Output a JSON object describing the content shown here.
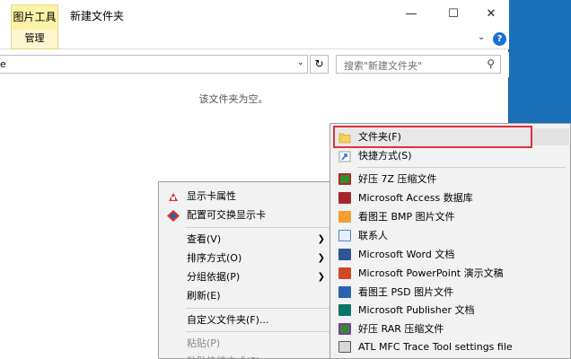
{
  "window": {
    "context_tab": "图片工具",
    "title": "新建文件夹",
    "ribbon_tab": "管理",
    "address_partial": "e",
    "search_placeholder": "搜索\"新建文件夹\"",
    "empty_message": "该文件夹为空。",
    "controls": {
      "minimize": "—",
      "maximize": "☐",
      "close": "✕"
    }
  },
  "context_menu": {
    "items": [
      {
        "label": "显示卡属性",
        "icon": "display-properties-icon"
      },
      {
        "label": "配置可交换显示卡",
        "icon": "switchable-graphics-icon"
      },
      {
        "label": "查看(V)",
        "submenu": true
      },
      {
        "label": "排序方式(O)",
        "submenu": true
      },
      {
        "label": "分组依据(P)",
        "submenu": true
      },
      {
        "label": "刷新(E)"
      },
      {
        "label": "自定义文件夹(F)..."
      },
      {
        "label": "粘贴(P)",
        "disabled": true
      },
      {
        "label": "粘贴快捷方式(S)",
        "disabled": true
      }
    ]
  },
  "new_submenu": {
    "items": [
      {
        "label": "文件夹(F)",
        "icon": "folder-icon",
        "color": "#f4d15a"
      },
      {
        "label": "快捷方式(S)",
        "icon": "shortcut-icon",
        "color": "#3c7bd0"
      },
      {
        "label": "好压 7Z 压缩文件",
        "icon": "haozip-7z-icon",
        "color": "#2f8f2f"
      },
      {
        "label": "Microsoft Access 数据库",
        "icon": "access-icon",
        "color": "#a4262c"
      },
      {
        "label": "看图王 BMP 图片文件",
        "icon": "bmp-icon",
        "color": "#f0a030"
      },
      {
        "label": "联系人",
        "icon": "contact-icon",
        "color": "#4a86c8"
      },
      {
        "label": "Microsoft Word 文档",
        "icon": "word-icon",
        "color": "#2b5797"
      },
      {
        "label": "Microsoft PowerPoint 演示文稿",
        "icon": "powerpoint-icon",
        "color": "#d24726"
      },
      {
        "label": "看图王 PSD 图片文件",
        "icon": "psd-icon",
        "color": "#2a62b0"
      },
      {
        "label": "Microsoft Publisher 文档",
        "icon": "publisher-icon",
        "color": "#077568"
      },
      {
        "label": "好压 RAR 压缩文件",
        "icon": "haozip-rar-icon",
        "color": "#2f8f2f"
      },
      {
        "label": "ATL MFC Trace Tool settings file",
        "icon": "atl-trace-icon",
        "color": "#555555"
      }
    ]
  }
}
